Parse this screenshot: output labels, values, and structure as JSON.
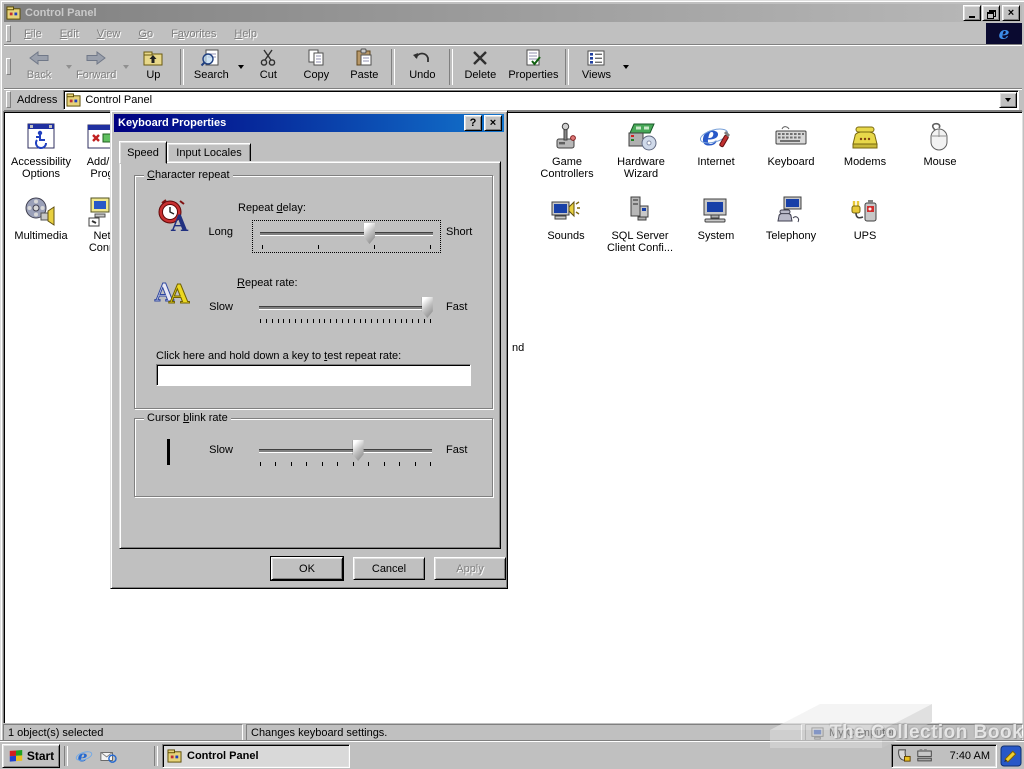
{
  "titlebar": {
    "title": "Control Panel"
  },
  "menu": {
    "items": [
      {
        "label": "File",
        "u": 0
      },
      {
        "label": "Edit",
        "u": 0
      },
      {
        "label": "View",
        "u": 0
      },
      {
        "label": "Go",
        "u": 0
      },
      {
        "label": "Favorites",
        "u": 1
      },
      {
        "label": "Help",
        "u": 0
      }
    ]
  },
  "toolbar": {
    "buttons": [
      {
        "label": "Back"
      },
      {
        "label": "Forward"
      },
      {
        "label": "Up"
      },
      {
        "label": "Search"
      },
      {
        "label": "Cut"
      },
      {
        "label": "Copy"
      },
      {
        "label": "Paste"
      },
      {
        "label": "Undo"
      },
      {
        "label": "Delete"
      },
      {
        "label": "Properties"
      },
      {
        "label": "Views"
      }
    ]
  },
  "address": {
    "label": "Address",
    "value": "Control Panel"
  },
  "icons": {
    "accessibility": {
      "line1": "Accessibility",
      "line2": "Options"
    },
    "addremove": {
      "line1": "Add/R",
      "line2": "Prog"
    },
    "multimedia": {
      "line1": "Multimedia",
      "line2": ""
    },
    "network": {
      "line1": "Net",
      "line2": "Conn"
    },
    "fragment": "nd",
    "game": {
      "line1": "Game",
      "line2": "Controllers"
    },
    "hardware": {
      "line1": "Hardware",
      "line2": "Wizard"
    },
    "internet": {
      "line1": "Internet",
      "line2": ""
    },
    "keyboard": {
      "line1": "Keyboard",
      "line2": ""
    },
    "modems": {
      "line1": "Modems",
      "line2": ""
    },
    "mouse": {
      "line1": "Mouse",
      "line2": ""
    },
    "sounds": {
      "line1": "Sounds",
      "line2": ""
    },
    "sql": {
      "line1": "SQL Server",
      "line2": "Client Confi..."
    },
    "system": {
      "line1": "System",
      "line2": ""
    },
    "telephony": {
      "line1": "Telephony",
      "line2": ""
    },
    "ups": {
      "line1": "UPS",
      "line2": ""
    }
  },
  "dialog": {
    "title": "Keyboard Properties",
    "help_glyph": "?",
    "close_glyph": "×",
    "tab_speed": "Speed",
    "tab_input": "Input Locales",
    "char_repeat": {
      "label": "Character repeat",
      "u": 0
    },
    "repeat_delay": {
      "label": "Repeat delay:",
      "u": 7,
      "min": "Long",
      "max": "Short",
      "value_pct": 63,
      "ticks": 4
    },
    "repeat_rate": {
      "label": "Repeat rate:",
      "u": 0,
      "min": "Slow",
      "max": "Fast",
      "value_pct": 97,
      "ticks": 30
    },
    "test": {
      "label": "Click here and hold down a key to test repeat rate:",
      "u": 34,
      "value": ""
    },
    "cursor_blink": {
      "label": "Cursor blink rate",
      "u": 7,
      "min": "Slow",
      "max": "Fast",
      "value_pct": 57,
      "ticks": 12
    },
    "ok": "OK",
    "cancel": "Cancel",
    "apply": "Apply"
  },
  "statusbar": {
    "objects": "1 object(s) selected",
    "hint": "Changes keyboard settings.",
    "zone": "My Computer"
  },
  "taskbar": {
    "start": "Start",
    "task": "Control Panel",
    "clock": "7:40 AM"
  },
  "watermark": "The Collection Book",
  "colors": {
    "title_inactive_1": "#818181",
    "title_inactive_2": "#b9b9b9",
    "title_active_1": "#000080",
    "title_active_2": "#1274cc",
    "chrome": "#c0c0c0"
  }
}
